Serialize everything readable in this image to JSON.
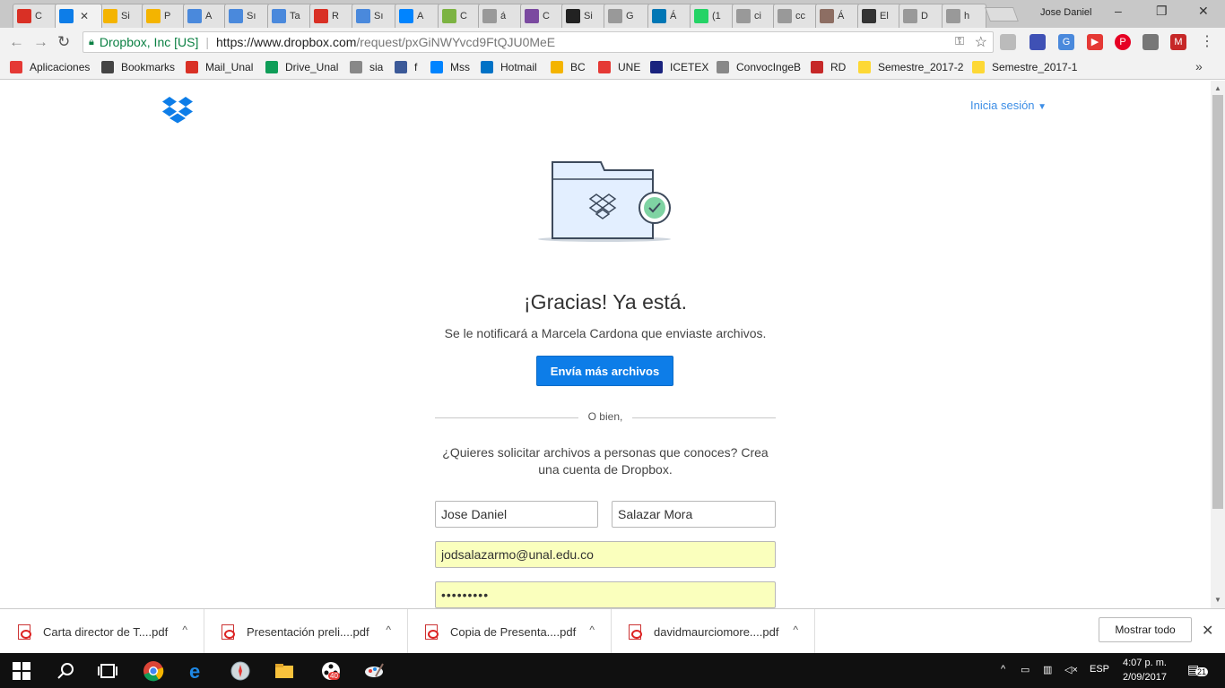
{
  "tabs": [
    {
      "label": "C",
      "icon": "gmail-icon",
      "color": "#d93025"
    },
    {
      "label": "",
      "icon": "dropbox-icon",
      "color": "#0d7de8"
    },
    {
      "label": "Si",
      "icon": "slides-icon",
      "color": "#f4b400"
    },
    {
      "label": "P",
      "icon": "slides-icon",
      "color": "#f4b400"
    },
    {
      "label": "A",
      "icon": "forms-icon",
      "color": "#4a89dc"
    },
    {
      "label": "Sı",
      "icon": "forms-icon",
      "color": "#4a89dc"
    },
    {
      "label": "Ta",
      "icon": "forms-icon",
      "color": "#4a89dc"
    },
    {
      "label": "R",
      "icon": "gmail-icon",
      "color": "#d93025"
    },
    {
      "label": "Sı",
      "icon": "docs-icon",
      "color": "#4a89dc"
    },
    {
      "label": "A",
      "icon": "messenger-icon",
      "color": "#0084ff"
    },
    {
      "label": "C",
      "icon": "chrome-icon",
      "color": "#7cb342"
    },
    {
      "label": "á",
      "icon": "google-icon",
      "color": "#999999"
    },
    {
      "label": "C",
      "icon": "kahoot-icon",
      "color": "#7b4aa0"
    },
    {
      "label": "Si",
      "icon": "bookmark-icon",
      "color": "#222222"
    },
    {
      "label": "G",
      "icon": "google-icon",
      "color": "#999999"
    },
    {
      "label": "Á",
      "icon": "linkedin-icon",
      "color": "#0077b5"
    },
    {
      "label": "(1",
      "icon": "whatsapp-icon",
      "color": "#25d366"
    },
    {
      "label": "ci",
      "icon": "google-icon",
      "color": "#999999"
    },
    {
      "label": "cc",
      "icon": "google-icon",
      "color": "#999999"
    },
    {
      "label": "Á",
      "icon": "crest-icon",
      "color": "#8d6e63"
    },
    {
      "label": "El",
      "icon": "chat-icon",
      "color": "#333333"
    },
    {
      "label": "D",
      "icon": "google-icon",
      "color": "#999999"
    },
    {
      "label": "h",
      "icon": "google-icon",
      "color": "#999999"
    }
  ],
  "profile_name": "Jose Daniel",
  "omnibox": {
    "secure_label": "Dropbox, Inc [US]",
    "url_host": "https://www.dropbox.com",
    "url_path": "/request/pxGiNWYvcd9FtQJU0MeE"
  },
  "bookmarks": [
    {
      "label": "Aplicaciones",
      "icon": "apps-icon",
      "color": "#e53935"
    },
    {
      "label": "Bookmarks",
      "icon": "star-icon",
      "color": "#444444"
    },
    {
      "label": "Mail_Unal",
      "icon": "gmail-icon",
      "color": "#d93025"
    },
    {
      "label": "Drive_Unal",
      "icon": "drive-icon",
      "color": "#0f9d58"
    },
    {
      "label": "sia",
      "icon": "page-icon",
      "color": "#888888"
    },
    {
      "label": "f",
      "icon": "facebook-icon",
      "color": "#3b5998"
    },
    {
      "label": "Mss",
      "icon": "messenger-icon",
      "color": "#0084ff"
    },
    {
      "label": "Hotmail",
      "icon": "outlook-icon",
      "color": "#0072c6"
    },
    {
      "label": "BC",
      "icon": "bank-icon",
      "color": "#f4b400"
    },
    {
      "label": "UNE",
      "icon": "une-icon",
      "color": "#e53935"
    },
    {
      "label": "ICETEX",
      "icon": "icetex-icon",
      "color": "#1a237e"
    },
    {
      "label": "ConvocIngeB",
      "icon": "gear-icon",
      "color": "#888888"
    },
    {
      "label": "RD",
      "icon": "rd-icon",
      "color": "#c62828"
    },
    {
      "label": "Semestre_2017-2",
      "icon": "folder-icon",
      "color": "#fdd835"
    },
    {
      "label": "Semestre_2017-1",
      "icon": "folder-icon",
      "color": "#fdd835"
    }
  ],
  "header": {
    "signin_label": "Inicia sesión"
  },
  "main": {
    "title": "¡Gracias! Ya está.",
    "subtitle": "Se le notificará a Marcela Cardona que enviaste archivos.",
    "primary_button": "Envía más archivos",
    "or_text": "O bien,",
    "pitch": "¿Quieres solicitar archivos a personas que conoces? Crea una cuenta de Dropbox."
  },
  "form": {
    "first_name": "Jose Daniel",
    "last_name": "Salazar Mora",
    "email": "jodsalazarmo@unal.edu.co",
    "password": "•••••••••"
  },
  "downloads": [
    {
      "label": "Carta director de T....pdf"
    },
    {
      "label": "Presentación preli....pdf"
    },
    {
      "label": "Copia de Presenta....pdf"
    },
    {
      "label": "davidmaurciomore....pdf"
    }
  ],
  "downloads_bar": {
    "show_all": "Mostrar todo"
  },
  "taskbar": {
    "language": "ESP",
    "time": "4:07 p. m.",
    "date": "2/09/2017",
    "badge_count": "40",
    "notification_count": "21"
  },
  "colors": {
    "accent": "#0d7de8",
    "link": "#3d8ee6",
    "autofill": "#faffbd"
  }
}
